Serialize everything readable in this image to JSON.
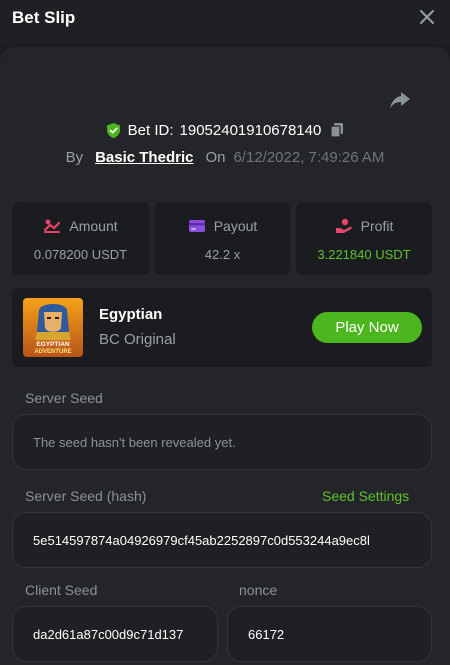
{
  "header": {
    "title": "Bet Slip",
    "close_icon": "close-icon"
  },
  "bet": {
    "id_label": "Bet ID:",
    "id_value": "19052401910678140",
    "by_label": "By",
    "username": "Basic Thedric",
    "on_label": "On",
    "date": "6/12/2022, 7:49:26 AM"
  },
  "stats": {
    "amount": {
      "label": "Amount",
      "value": "0.078200 USDT",
      "icon": "amount-icon"
    },
    "payout": {
      "label": "Payout",
      "value": "42.2 x",
      "icon": "payout-card-icon"
    },
    "profit": {
      "label": "Profit",
      "value": "3.221840 USDT",
      "icon": "profit-hand-icon"
    }
  },
  "game": {
    "name": "Egyptian",
    "subtitle": "BC Original",
    "thumb_text_1": "EGYPTIAN",
    "thumb_text_2": "ADVENTURE",
    "play_label": "Play Now"
  },
  "seeds": {
    "server_seed_label": "Server Seed",
    "server_seed_placeholder": "The seed hasn't been revealed yet.",
    "server_hash_label": "Server Seed (hash)",
    "seed_settings_label": "Seed Settings",
    "server_hash_value": "5e514597874a04926979cf45ab2252897c0d553244a9ec8l",
    "client_seed_label": "Client Seed",
    "client_seed_value": "da2d61a87c00d9c71d137",
    "nonce_label": "nonce",
    "nonce_value": "66172"
  },
  "colors": {
    "accent_green": "#5ec12d",
    "button_green": "#4cb61f",
    "background": "#1c1d20",
    "panel": "#242528"
  }
}
